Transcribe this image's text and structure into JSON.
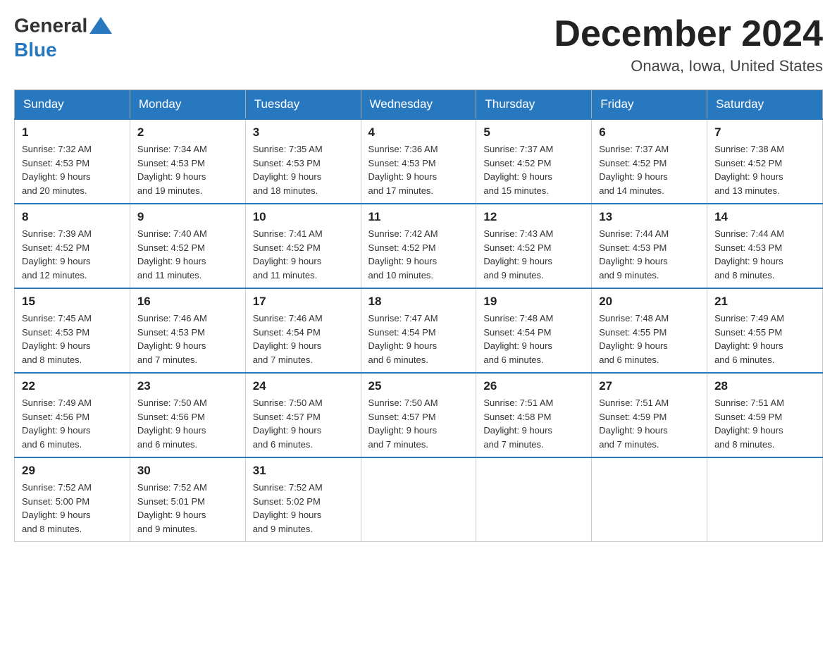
{
  "header": {
    "logo_text_general": "General",
    "logo_text_blue": "Blue",
    "month_title": "December 2024",
    "location": "Onawa, Iowa, United States"
  },
  "days_of_week": [
    "Sunday",
    "Monday",
    "Tuesday",
    "Wednesday",
    "Thursday",
    "Friday",
    "Saturday"
  ],
  "weeks": [
    [
      {
        "day": "1",
        "sunrise": "7:32 AM",
        "sunset": "4:53 PM",
        "daylight": "9 hours and 20 minutes."
      },
      {
        "day": "2",
        "sunrise": "7:34 AM",
        "sunset": "4:53 PM",
        "daylight": "9 hours and 19 minutes."
      },
      {
        "day": "3",
        "sunrise": "7:35 AM",
        "sunset": "4:53 PM",
        "daylight": "9 hours and 18 minutes."
      },
      {
        "day": "4",
        "sunrise": "7:36 AM",
        "sunset": "4:53 PM",
        "daylight": "9 hours and 17 minutes."
      },
      {
        "day": "5",
        "sunrise": "7:37 AM",
        "sunset": "4:52 PM",
        "daylight": "9 hours and 15 minutes."
      },
      {
        "day": "6",
        "sunrise": "7:37 AM",
        "sunset": "4:52 PM",
        "daylight": "9 hours and 14 minutes."
      },
      {
        "day": "7",
        "sunrise": "7:38 AM",
        "sunset": "4:52 PM",
        "daylight": "9 hours and 13 minutes."
      }
    ],
    [
      {
        "day": "8",
        "sunrise": "7:39 AM",
        "sunset": "4:52 PM",
        "daylight": "9 hours and 12 minutes."
      },
      {
        "day": "9",
        "sunrise": "7:40 AM",
        "sunset": "4:52 PM",
        "daylight": "9 hours and 11 minutes."
      },
      {
        "day": "10",
        "sunrise": "7:41 AM",
        "sunset": "4:52 PM",
        "daylight": "9 hours and 11 minutes."
      },
      {
        "day": "11",
        "sunrise": "7:42 AM",
        "sunset": "4:52 PM",
        "daylight": "9 hours and 10 minutes."
      },
      {
        "day": "12",
        "sunrise": "7:43 AM",
        "sunset": "4:52 PM",
        "daylight": "9 hours and 9 minutes."
      },
      {
        "day": "13",
        "sunrise": "7:44 AM",
        "sunset": "4:53 PM",
        "daylight": "9 hours and 9 minutes."
      },
      {
        "day": "14",
        "sunrise": "7:44 AM",
        "sunset": "4:53 PM",
        "daylight": "9 hours and 8 minutes."
      }
    ],
    [
      {
        "day": "15",
        "sunrise": "7:45 AM",
        "sunset": "4:53 PM",
        "daylight": "9 hours and 8 minutes."
      },
      {
        "day": "16",
        "sunrise": "7:46 AM",
        "sunset": "4:53 PM",
        "daylight": "9 hours and 7 minutes."
      },
      {
        "day": "17",
        "sunrise": "7:46 AM",
        "sunset": "4:54 PM",
        "daylight": "9 hours and 7 minutes."
      },
      {
        "day": "18",
        "sunrise": "7:47 AM",
        "sunset": "4:54 PM",
        "daylight": "9 hours and 6 minutes."
      },
      {
        "day": "19",
        "sunrise": "7:48 AM",
        "sunset": "4:54 PM",
        "daylight": "9 hours and 6 minutes."
      },
      {
        "day": "20",
        "sunrise": "7:48 AM",
        "sunset": "4:55 PM",
        "daylight": "9 hours and 6 minutes."
      },
      {
        "day": "21",
        "sunrise": "7:49 AM",
        "sunset": "4:55 PM",
        "daylight": "9 hours and 6 minutes."
      }
    ],
    [
      {
        "day": "22",
        "sunrise": "7:49 AM",
        "sunset": "4:56 PM",
        "daylight": "9 hours and 6 minutes."
      },
      {
        "day": "23",
        "sunrise": "7:50 AM",
        "sunset": "4:56 PM",
        "daylight": "9 hours and 6 minutes."
      },
      {
        "day": "24",
        "sunrise": "7:50 AM",
        "sunset": "4:57 PM",
        "daylight": "9 hours and 6 minutes."
      },
      {
        "day": "25",
        "sunrise": "7:50 AM",
        "sunset": "4:57 PM",
        "daylight": "9 hours and 7 minutes."
      },
      {
        "day": "26",
        "sunrise": "7:51 AM",
        "sunset": "4:58 PM",
        "daylight": "9 hours and 7 minutes."
      },
      {
        "day": "27",
        "sunrise": "7:51 AM",
        "sunset": "4:59 PM",
        "daylight": "9 hours and 7 minutes."
      },
      {
        "day": "28",
        "sunrise": "7:51 AM",
        "sunset": "4:59 PM",
        "daylight": "9 hours and 8 minutes."
      }
    ],
    [
      {
        "day": "29",
        "sunrise": "7:52 AM",
        "sunset": "5:00 PM",
        "daylight": "9 hours and 8 minutes."
      },
      {
        "day": "30",
        "sunrise": "7:52 AM",
        "sunset": "5:01 PM",
        "daylight": "9 hours and 9 minutes."
      },
      {
        "day": "31",
        "sunrise": "7:52 AM",
        "sunset": "5:02 PM",
        "daylight": "9 hours and 9 minutes."
      },
      null,
      null,
      null,
      null
    ]
  ],
  "labels": {
    "sunrise": "Sunrise:",
    "sunset": "Sunset:",
    "daylight": "Daylight:"
  }
}
